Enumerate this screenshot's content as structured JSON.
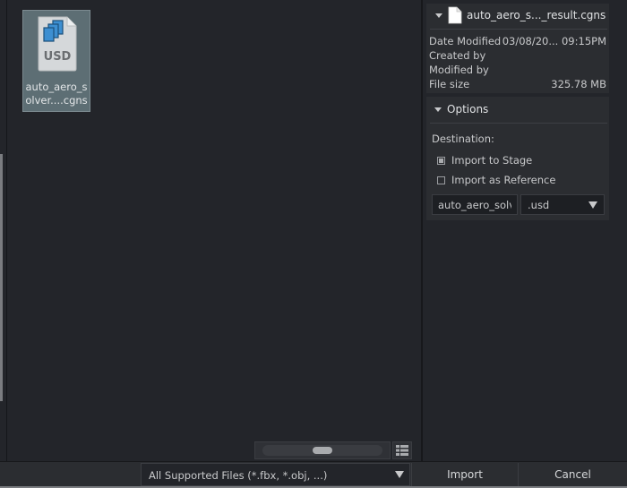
{
  "file_browser": {
    "files": [
      {
        "name": "auto_aero_s\nolver....cgns",
        "icon": "usd-file-icon",
        "icon_label": "USD",
        "selected": true
      }
    ]
  },
  "info_panel": {
    "filename": "auto_aero_s..._result.cgns",
    "fields": [
      {
        "label": "Date Modified",
        "value": "03/08/20... 09:15PM"
      },
      {
        "label": "Created by",
        "value": ""
      },
      {
        "label": "Modified by",
        "value": ""
      },
      {
        "label": "File size",
        "value": "325.78 MB"
      }
    ]
  },
  "options_panel": {
    "title": "Options",
    "destination_label": "Destination:",
    "radios": [
      {
        "label": "Import to Stage",
        "checked": true
      },
      {
        "label": "Import as Reference",
        "checked": false
      }
    ],
    "name_input_value": "auto_aero_solv",
    "extension_value": ".usd"
  },
  "bottom_bar": {
    "filter_label": "All Supported Files (*.fbx, *.obj, ...)",
    "import_label": "Import",
    "cancel_label": "Cancel"
  },
  "colors": {
    "background": "#23252a",
    "panel": "#2b2d31",
    "selected_tile": "#5d6e74",
    "usd_icon_blue": "#3d8fd1"
  }
}
